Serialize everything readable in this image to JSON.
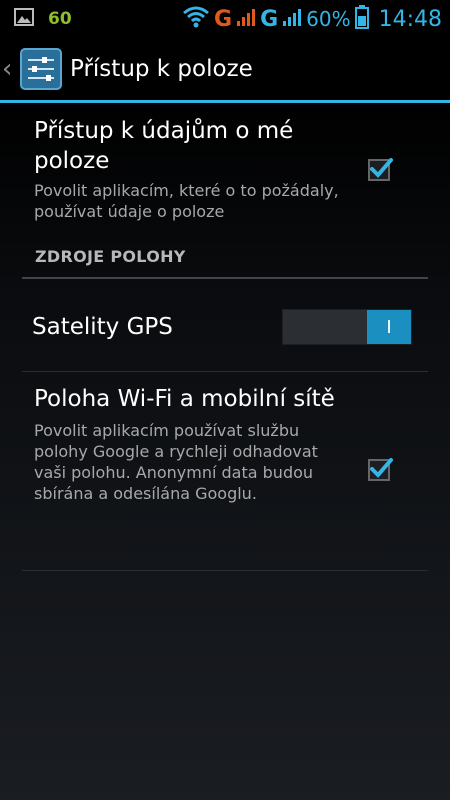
{
  "status_bar": {
    "gallery_icon": "image-icon",
    "battery_level_small": "60",
    "network_g1": "G",
    "network_g2": "G",
    "battery_percent": "60%",
    "time": "14:48"
  },
  "action_bar": {
    "title": "Přístup k poloze",
    "icon": "settings-sliders-icon"
  },
  "prefs": {
    "access": {
      "title": "Přístup k údajům o mé poloze",
      "summary": "Povolit aplikacím, které o to požádaly, používat údaje o poloze",
      "checked": true
    },
    "section_header": "ZDROJE POLOHY",
    "gps": {
      "title": "Satelity GPS",
      "toggle_state": "on",
      "toggle_label": "I"
    },
    "wifi": {
      "title": "Poloha Wi-Fi a mobilní sítě",
      "summary": "Povolit aplikacím používat službu polohy Google a rychleji odhadovat vaši polohu. Anonymní data budou sbírána a odesílána Googlu.",
      "checked": true
    }
  },
  "colors": {
    "accent": "#33b5e5",
    "switch_on": "#1c8fc1",
    "summary_text": "#a8a8a8"
  }
}
